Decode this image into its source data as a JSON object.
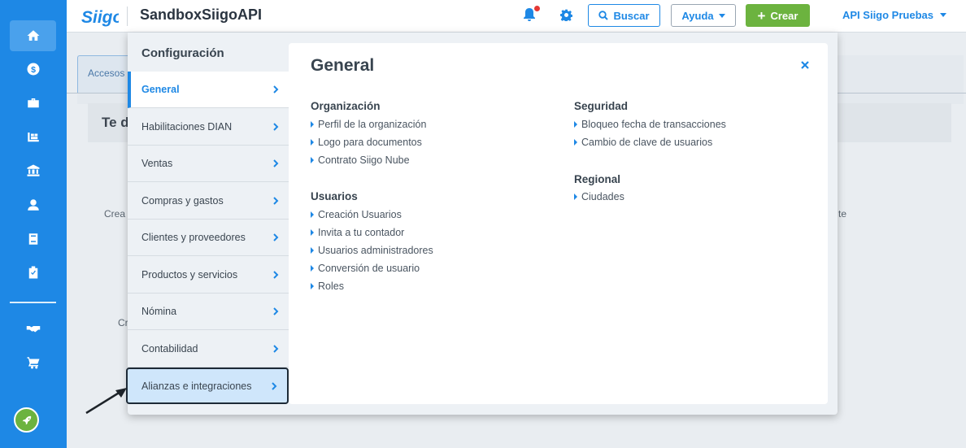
{
  "app": {
    "title": "SandboxSiigoAPI",
    "logo_text": "Siigo"
  },
  "topbar": {
    "search_label": "Buscar",
    "help_label": "Ayuda",
    "create_label": "Crear",
    "user_label": "API Siigo Pruebas"
  },
  "rail": {
    "icons": [
      "home-icon",
      "dollar-icon",
      "briefcase-icon",
      "warehouse-icon",
      "bank-icon",
      "user-icon",
      "book-icon",
      "clipboard-check-icon",
      "handshake-icon",
      "cart-icon",
      "rocket-icon"
    ]
  },
  "background": {
    "tab_label": "Accesos",
    "section_title": "Te d",
    "text_left_1": "Crea",
    "text_left_2": "Cr",
    "text_right": "te"
  },
  "config": {
    "menu_title": "Configuración",
    "menu": [
      {
        "label": "General"
      },
      {
        "label": "Habilitaciones DIAN"
      },
      {
        "label": "Ventas"
      },
      {
        "label": "Compras y gastos"
      },
      {
        "label": "Clientes y proveedores"
      },
      {
        "label": "Productos y servicios"
      },
      {
        "label": "Nómina"
      },
      {
        "label": "Contabilidad"
      },
      {
        "label": "Alianzas e integraciones"
      }
    ],
    "content_title": "General",
    "sections": {
      "organizacion": {
        "title": "Organización",
        "links": [
          "Perfil de la organización",
          "Logo para documentos",
          "Contrato Siigo Nube"
        ]
      },
      "usuarios": {
        "title": "Usuarios",
        "links": [
          "Creación Usuarios",
          "Invita a tu contador",
          "Usuarios administradores",
          "Conversión de usuario",
          "Roles"
        ]
      },
      "seguridad": {
        "title": "Seguridad",
        "links": [
          "Bloqueo fecha de transacciones",
          "Cambio de clave de usuarios"
        ]
      },
      "regional": {
        "title": "Regional",
        "links": [
          "Ciudades"
        ]
      }
    }
  },
  "colors": {
    "primary": "#1e88e5",
    "success": "#6cb33f",
    "alert": "#e53935"
  }
}
